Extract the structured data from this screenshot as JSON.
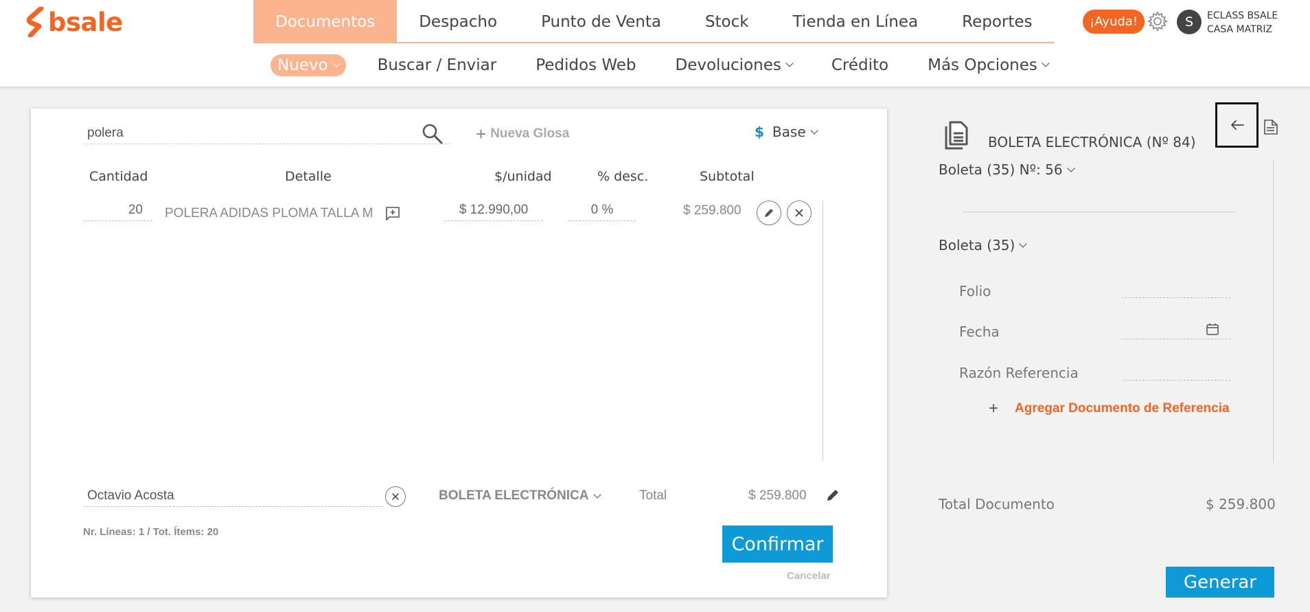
{
  "brand": {
    "logo_text": "bsale",
    "logo_color": "#f26522"
  },
  "main_nav": [
    {
      "label": "Documentos",
      "active": true
    },
    {
      "label": "Despacho"
    },
    {
      "label": "Punto de Venta"
    },
    {
      "label": "Stock"
    },
    {
      "label": "Tienda en Línea"
    },
    {
      "label": "Reportes"
    }
  ],
  "header": {
    "help_label": "¡Ayuda!",
    "avatar_initial": "S",
    "account_line1": "ECLASS BSALE",
    "account_line2": "CASA MATRIZ"
  },
  "sub_nav": [
    {
      "label": "Nuevo",
      "active": true
    },
    {
      "label": "Buscar / Enviar"
    },
    {
      "label": "Pedidos Web"
    },
    {
      "label": "Devoluciones"
    },
    {
      "label": "Crédito"
    },
    {
      "label": "Más Opciones"
    }
  ],
  "editor": {
    "search_value": "polera",
    "glosa_label": "Nueva Glosa",
    "price_symbol": "$",
    "price_list": "Base",
    "columns": {
      "quantity": "Cantidad",
      "detail": "Detalle",
      "unit_price": "$/unidad",
      "discount": "% desc.",
      "subtotal": "Subtotal"
    },
    "rows": [
      {
        "quantity": "20",
        "detail": "POLERA ADIDAS PLOMA TALLA M",
        "unit_price": "$ 12.990,00",
        "discount": "0 %",
        "subtotal": "$ 259.800"
      }
    ],
    "client": "Octavio Acosta",
    "doc_type": "BOLETA ELECTRÓNICA",
    "total_label": "Total",
    "total_value": "$ 259.800",
    "lines_info": "Nr. Líneas: 1 / Tot. Ítems: 20",
    "confirm_label": "Confirmar",
    "cancel_label": "Cancelar"
  },
  "panel": {
    "title": "BOLETA ELECTRÓNICA (Nº 84)",
    "series_select": "Boleta (35) Nº: 56",
    "ref_doc_select": "Boleta (35)",
    "folio_label": "Folio",
    "date_label": "Fecha",
    "reason_label": "Razón Referencia",
    "add_ref_label": "Agregar Documento de Referencia",
    "total_doc_label": "Total Documento",
    "total_doc_value": "$ 259.800",
    "generate_label": "Generar"
  },
  "colors": {
    "accent_orange": "#f26522",
    "active_nav_bg": "#fcb48f",
    "primary_button": "#0d9ad6"
  }
}
